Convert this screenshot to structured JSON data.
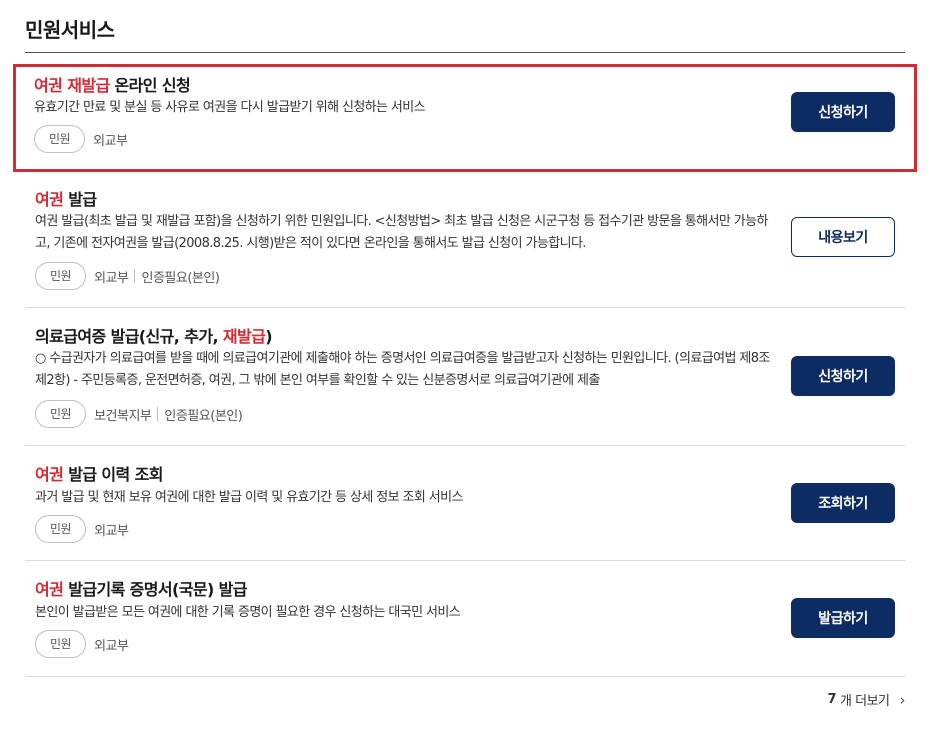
{
  "section": {
    "title": "민원서비스"
  },
  "items": [
    {
      "title_hl": "여권 재발급",
      "title_rest": " 온라인 신청",
      "desc": "유효기간 만료 및 분실 등 사유로 여권을 다시 발급받기 위해 신청하는 서비스",
      "chip": "민원",
      "org": "외교부",
      "extra": "",
      "button": "신청하기"
    },
    {
      "title_hl": "여권",
      "title_rest": " 발급",
      "desc": "여권 발급(최초 발급 및 재발급 포함)을 신청하기 위한 민원입니다. <신청방법> 최초 발급 신청은 시군구청 등 접수기관 방문을 통해서만 가능하고, 기존에 전자여권을 발급(2008.8.25. 시행)받은 적이 있다면 온라인을 통해서도 발급 신청이 가능합니다.",
      "chip": "민원",
      "org": "외교부",
      "extra": "인증필요(본인)",
      "button": "내용보기"
    },
    {
      "title_pre": "의료급여증 발급(신규, 추가, ",
      "title_hl": "재발급",
      "title_post": ")",
      "desc": "○ 수급권자가 의료급여를 받을 때에 의료급여기관에 제출해야 하는 증명서인 의료급여증을 발급받고자 신청하는 민원입니다. (의료급여법 제8조제2항) - 주민등록증, 운전면허증, 여권, 그 밖에 본인 여부를 확인할 수 있는 신분증명서로 의료급여기관에 제출",
      "chip": "민원",
      "org": "보건복지부",
      "extra": "인증필요(본인)",
      "button": "신청하기"
    },
    {
      "title_hl": "여권",
      "title_rest": " 발급 이력 조회",
      "desc": "과거 발급 및 현재 보유 여권에 대한 발급 이력 및 유효기간 등 상세 정보 조회 서비스",
      "chip": "민원",
      "org": "외교부",
      "extra": "",
      "button": "조회하기"
    },
    {
      "title_hl": "여권",
      "title_rest": " 발급기록 증명서(국문) 발급",
      "desc": "본인이 발급받은 모든 여권에 대한 기록 증명이 필요한 경우 신청하는 대국민 서비스",
      "chip": "민원",
      "org": "외교부",
      "extra": "",
      "button": "발급하기"
    }
  ],
  "more": {
    "count": "7",
    "label": "개 더보기",
    "icon": "chevron-right-icon"
  },
  "colors": {
    "highlight": "#d42a35",
    "primary": "#0c2c63"
  }
}
